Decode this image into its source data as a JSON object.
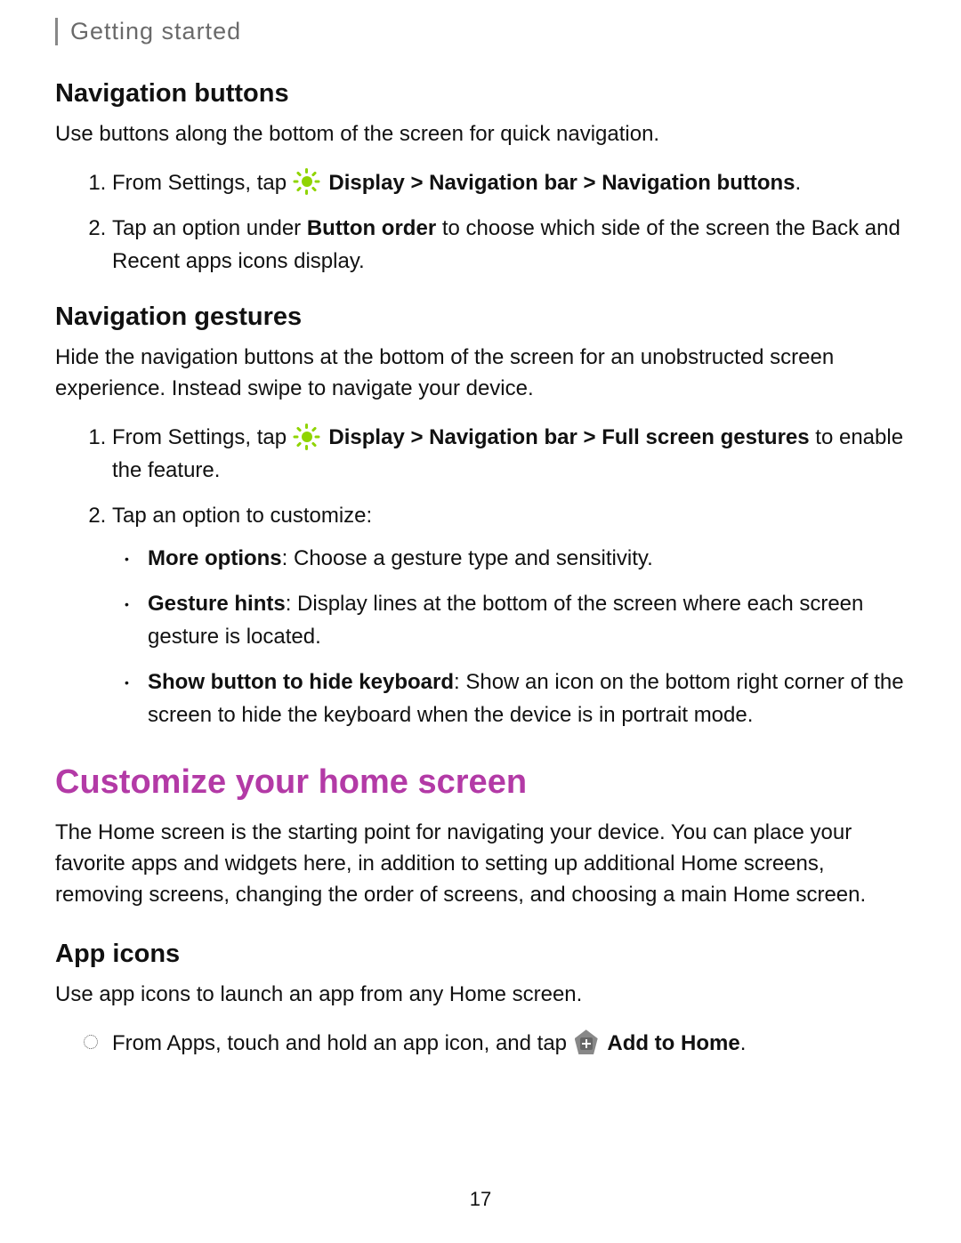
{
  "running_head": "Getting started",
  "accent_color": "#b33aa6",
  "icon_color_display": "#8fd400",
  "page_number": "17",
  "sections": {
    "nav_buttons": {
      "heading": "Navigation buttons",
      "intro": "Use buttons along the bottom of the screen for quick navigation.",
      "step1_pre": "From Settings, tap ",
      "step1_bold": "Display > Navigation bar > Navigation buttons",
      "step1_post": ".",
      "step2_pre": "Tap an option under ",
      "step2_bold": "Button order",
      "step2_post": " to choose which side of the screen the Back and Recent apps icons display."
    },
    "nav_gestures": {
      "heading": "Navigation gestures",
      "intro": "Hide the navigation buttons at the bottom of the screen for an unobstructed screen experience. Instead swipe to navigate your device.",
      "step1_pre": "From Settings, tap ",
      "step1_bold": "Display > Navigation bar > Full screen gestures",
      "step1_post": " to enable the feature.",
      "step2": "Tap an option to customize:",
      "bullets": {
        "b1_bold": "More options",
        "b1_rest": ": Choose a gesture type and sensitivity.",
        "b2_bold": "Gesture hints",
        "b2_rest": ": Display lines at the bottom of the screen where each screen gesture is located.",
        "b3_bold": "Show button to hide keyboard",
        "b3_rest": ": Show an icon on the bottom right corner of the screen to hide the keyboard when the device is in portrait mode."
      }
    },
    "customize_home": {
      "title": "Customize your home screen",
      "intro": "The Home screen is the starting point for navigating your device. You can place your favorite apps and widgets here, in addition to setting up additional Home screens, removing screens, changing the order of screens, and choosing a main Home screen."
    },
    "app_icons": {
      "heading": "App icons",
      "intro": "Use app icons to launch an app from any Home screen.",
      "step_pre": "From Apps, touch and hold an app icon, and tap ",
      "step_bold": "Add to Home",
      "step_post": "."
    }
  }
}
